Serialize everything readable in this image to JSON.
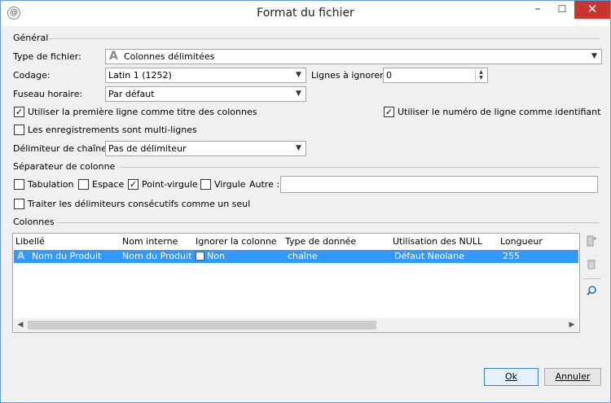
{
  "window": {
    "title": "Format du fichier",
    "controls": {
      "minimize": "–",
      "maximize": "☐",
      "close": "✕"
    }
  },
  "general": {
    "section_label": "Général",
    "file_type_label": "Type de fichier:",
    "file_type_value": "Colonnes délimitées",
    "file_type_icon_glyph": "A",
    "encoding_label": "Codage:",
    "encoding_value": "Latin 1 (1252)",
    "skip_lines_label": "Lignes à ignorer:",
    "skip_lines_value": "0",
    "timezone_label": "Fuseau horaire:",
    "timezone_value": "Par défaut",
    "first_line_titles_label": "Utiliser la première ligne comme titre des colonnes",
    "first_line_titles_checked": true,
    "line_number_id_label": "Utiliser le numéro de ligne comme identifiant",
    "line_number_id_checked": true,
    "multiline_label": "Les enregistrements sont multi-lignes",
    "multiline_checked": false,
    "string_delimiter_label": "Délimiteur de chaîne:",
    "string_delimiter_value": "Pas de délimiteur"
  },
  "separator": {
    "section_label": "Séparateur de colonne",
    "tab_label": "Tabulation",
    "tab_checked": false,
    "space_label": "Espace",
    "space_checked": false,
    "semicolon_label": "Point-virgule",
    "semicolon_checked": true,
    "comma_label": "Virgule",
    "comma_checked": false,
    "other_label": "Autre :",
    "other_value": "",
    "consecutive_label": "Traiter les délimiteurs consécutifs comme un seul",
    "consecutive_checked": false
  },
  "columns": {
    "section_label": "Colonnes",
    "headers": [
      "Libellé",
      "Nom interne",
      "Ignorer la colonne",
      "Type de donnée",
      "Utilisation des NULL",
      "Longueur"
    ],
    "rows": [
      {
        "label": "Nom du Produit",
        "internal": "Nom du Produit",
        "ignore": "Non",
        "type": "chaîne",
        "nulls": "Défaut Neolane",
        "length": "255"
      }
    ],
    "side_icons": [
      "add-column-icon",
      "delete-icon",
      "search-icon"
    ]
  },
  "buttons": {
    "ok": "Ok",
    "cancel": "Annuler"
  },
  "colors": {
    "selection": "#3399ff",
    "close_button": "#c7372f",
    "background": "#f0f0f0"
  }
}
